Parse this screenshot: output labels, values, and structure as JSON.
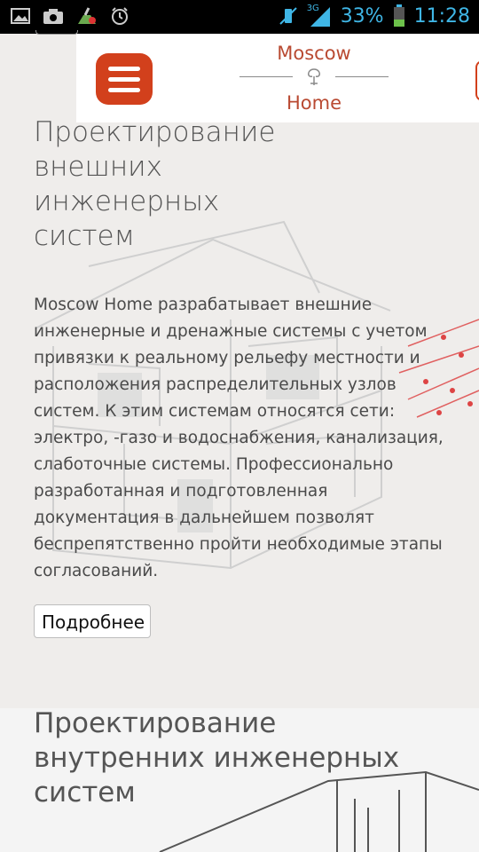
{
  "status_bar": {
    "network": "3G",
    "battery": "33%",
    "time": "11:28"
  },
  "header": {
    "logo_top": "Moscow",
    "logo_bottom": "Home",
    "brand_color": "#d2401c"
  },
  "section1": {
    "title": "Проектирование внешних инженерных систем",
    "body": "Moscow Home разрабатывает внешние инженерные и дренажные системы с учетом привязки к реальному рельефу местности и расположения распределительных узлов систем. К этим системам относятся сети: электро, -газо и водоснабжения, канализация, слаботочные системы. Профессионально разработанная и подготовленная документация в дальнейшем позволят беспрепятственно пройти необходимые этапы согласований.",
    "button_label": "Подробнее"
  },
  "section2": {
    "title": "Проектирование внутренних инженерных систем"
  }
}
